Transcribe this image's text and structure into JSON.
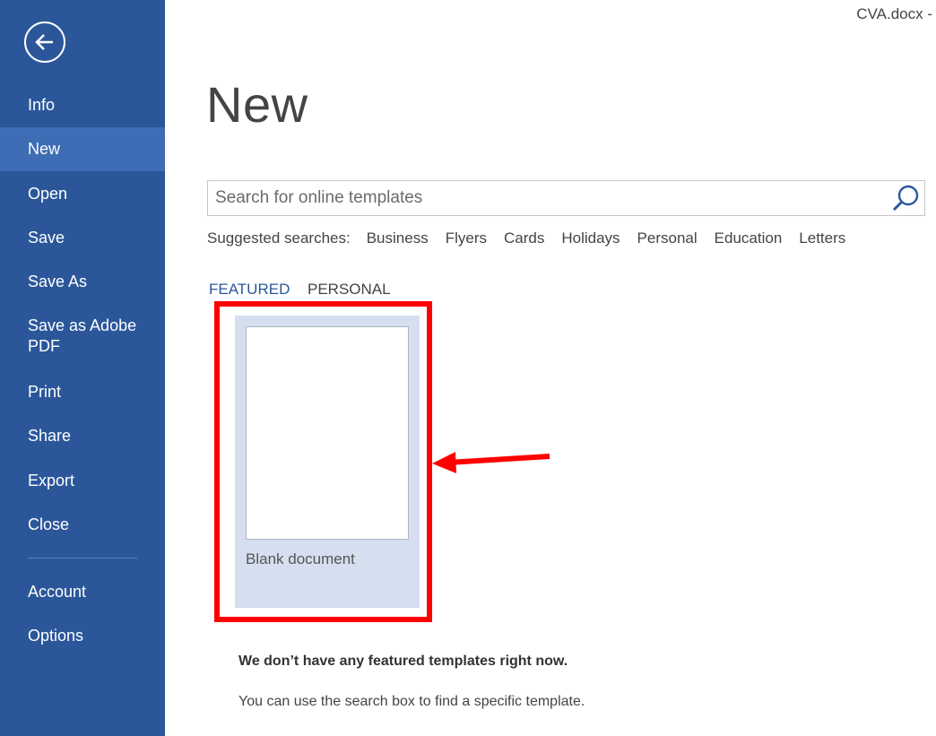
{
  "window": {
    "title": "CVA.docx -"
  },
  "sidebar": {
    "back_icon": "back-arrow-icon",
    "items": [
      {
        "label": "Info"
      },
      {
        "label": "New",
        "active": true
      },
      {
        "label": "Open"
      },
      {
        "label": "Save"
      },
      {
        "label": "Save As"
      },
      {
        "label": "Save as Adobe PDF"
      },
      {
        "label": "Print"
      },
      {
        "label": "Share"
      },
      {
        "label": "Export"
      },
      {
        "label": "Close"
      },
      {
        "label": "Account"
      },
      {
        "label": "Options"
      }
    ]
  },
  "main": {
    "title": "New",
    "search": {
      "placeholder": "Search for online templates",
      "value": "",
      "icon": "search-icon"
    },
    "suggested": {
      "label": "Suggested searches:",
      "links": [
        "Business",
        "Flyers",
        "Cards",
        "Holidays",
        "Personal",
        "Education",
        "Letters"
      ]
    },
    "tabs": [
      {
        "label": "FEATURED",
        "active": true
      },
      {
        "label": "PERSONAL",
        "active": false
      }
    ],
    "templates": [
      {
        "label": "Blank document"
      }
    ],
    "message_bold": "We don’t have any featured templates right now.",
    "message": "You can use the search box to find a specific template."
  },
  "colors": {
    "sidebar_bg": "#2b579a",
    "sidebar_active": "#3e6db5",
    "accent": "#2b579a",
    "tile_bg": "#d5dfef",
    "annotation": "#ff0000"
  }
}
